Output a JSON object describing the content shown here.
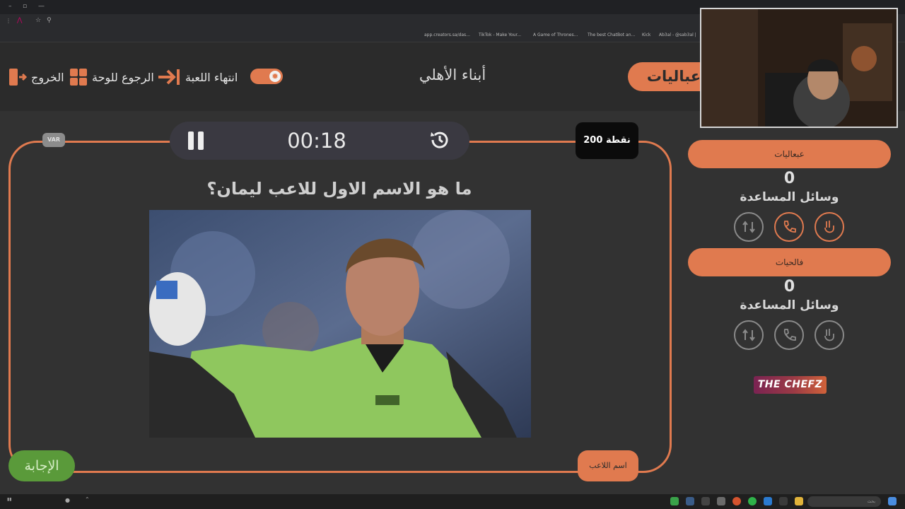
{
  "browser": {
    "bookmarks": [
      "app.creators.sa/das...",
      "TikTok - Make Your...",
      "A Game of Thrones...",
      "The best ChatBot an...",
      "Kick",
      "Ab3al - @sab3al |"
    ]
  },
  "header": {
    "exit_label": "الخروج",
    "back_to_board_label": "الرجوع للوحة",
    "end_game_label": "انتهاء اللعبة",
    "game_title": "أبناء الأهلي",
    "active_team": "عباليات"
  },
  "board": {
    "timer": "00:18",
    "var_label": "VAR",
    "points": "200 نقطة",
    "question": "ما هو الاسم الاول للاعب ليمان؟",
    "answer_button": "الإجابة",
    "hint_button": "اسم اللاعب"
  },
  "teams": [
    {
      "name": "عبعاليات",
      "score": "0",
      "aids_title": "وسائل المساعدة"
    },
    {
      "name": "فالحيات",
      "score": "0",
      "aids_title": "وسائل المساعدة"
    }
  ],
  "logo": "THE CHEFZ",
  "taskbar": {
    "search_placeholder": "بحث"
  },
  "colors": {
    "accent": "#e07a4f",
    "answer": "#5a9a3a",
    "background": "#323232"
  }
}
